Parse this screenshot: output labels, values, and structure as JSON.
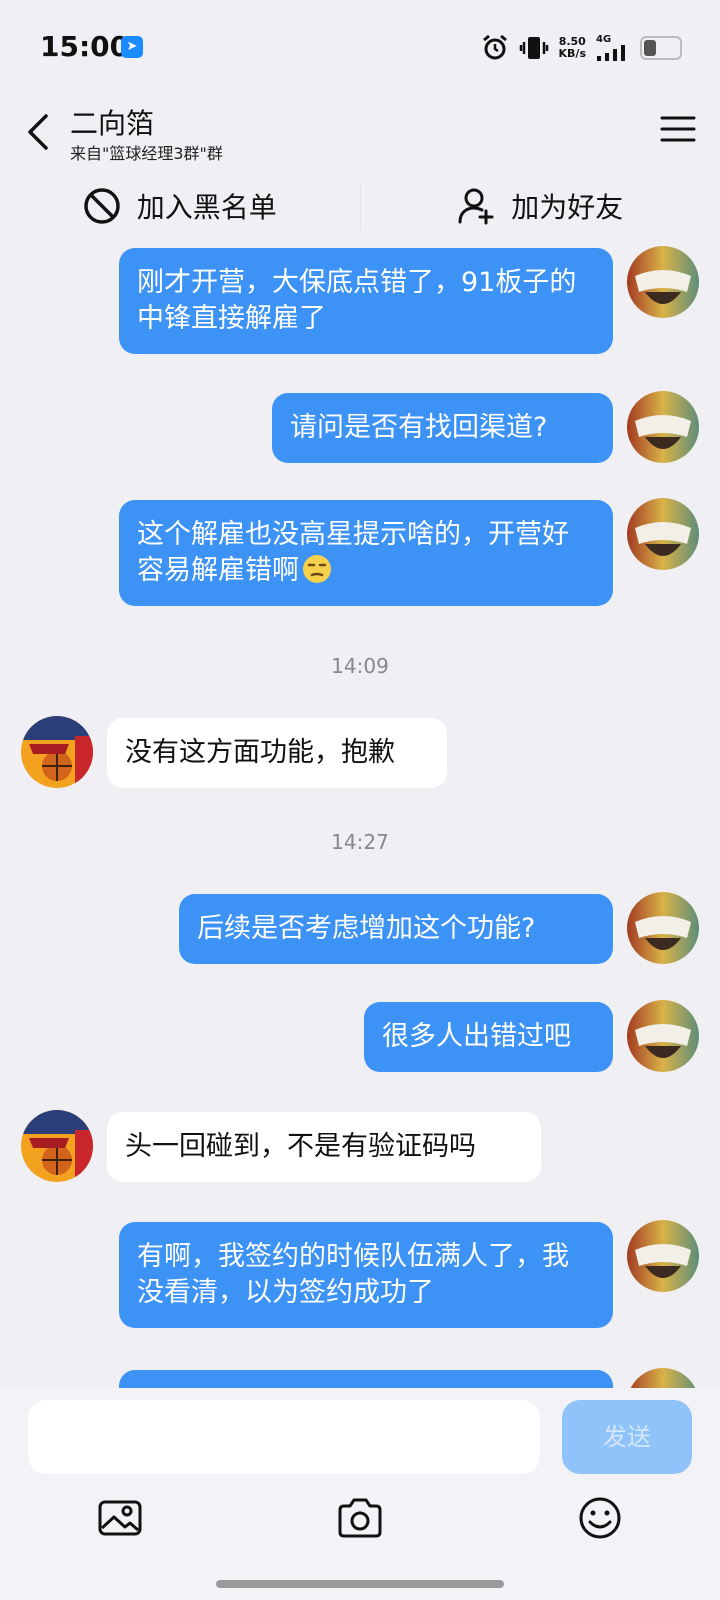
{
  "status": {
    "time": "15:00",
    "speed_value": "8.50",
    "speed_unit": "KB/s",
    "network": "4G",
    "battery_level": 0.35
  },
  "header": {
    "title": "二向箔",
    "subtitle": "来自\"篮球经理3群\"群"
  },
  "actions": {
    "block": "加入黑名单",
    "add_friend": "加为好友"
  },
  "messages": [
    {
      "sender": "self",
      "text": "刚才开营，大保底点错了，91板子的中锋直接解雇了"
    },
    {
      "sender": "self",
      "text": "请问是否有找回渠道?"
    },
    {
      "sender": "self",
      "text": "这个解雇也没高星提示啥的，开营好容易解雇错啊"
    },
    {
      "type": "time",
      "text": "14:09"
    },
    {
      "sender": "other",
      "text": "没有这方面功能，抱歉"
    },
    {
      "type": "time",
      "text": "14:27"
    },
    {
      "sender": "self",
      "text": "后续是否考虑增加这个功能?"
    },
    {
      "sender": "self",
      "text": "很多人出错过吧"
    },
    {
      "sender": "other",
      "text": "头一回碰到，不是有验证码吗"
    },
    {
      "sender": "self",
      "text": "有啊，我签约的时候队伍满人了，我没看清，以为签约成功了"
    }
  ],
  "input": {
    "placeholder": "",
    "send_label": "发送"
  },
  "toolbar": {
    "image": "image-icon",
    "camera": "camera-icon",
    "emoji": "emoji-icon"
  },
  "colors": {
    "self_bubble": "#3d92f5",
    "other_bubble": "#ffffff",
    "background": "#f0f0f4"
  }
}
